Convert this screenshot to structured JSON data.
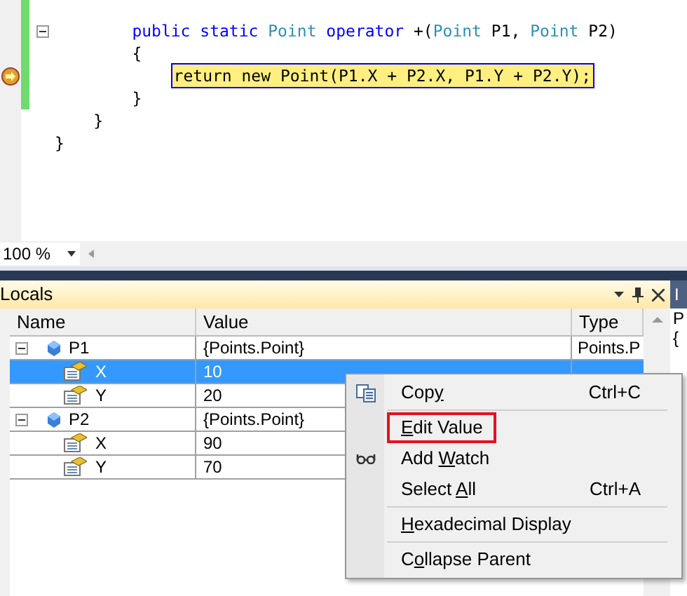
{
  "editor": {
    "lines": [
      {
        "children": [
          {
            "children": [
              {
                "collapsible": true,
                "current": false,
                "tokens": [
                  {
                    "kind": "keyword",
                    "text": "public static "
                  },
                  {
                    "kind": "type",
                    "text": "Point "
                  },
                  {
                    "kind": "keyword",
                    "text": "operator "
                  },
                  {
                    "kind": "plain",
                    "text": "+("
                  },
                  {
                    "kind": "type",
                    "text": "Point "
                  },
                  {
                    "kind": "plain",
                    "text": "P1, "
                  },
                  {
                    "kind": "type",
                    "text": "Point "
                  },
                  {
                    "kind": "plain",
                    "text": "P2)"
                  }
                ]
              },
              {
                "collapsible": false,
                "current": false,
                "tokens": [
                  {
                    "kind": "plain",
                    "text": "{"
                  }
                ],
                "children": [
                  {
                    "collapsible": false,
                    "current": true,
                    "tokens": [
                      {
                        "kind": "plain",
                        "text": "return new Point(P1.X + P2.X, P1.Y + P2.Y);"
                      }
                    ]
                  }
                ]
              },
              {
                "collapsible": false,
                "current": false,
                "tokens": [
                  {
                    "kind": "plain",
                    "text": "}"
                  }
                ]
              }
            ]
          },
          {
            "collapsible": false,
            "current": false,
            "tokens": [
              {
                "kind": "plain",
                "text": "}"
              }
            ]
          }
        ]
      },
      {
        "collapsible": false,
        "current": false,
        "tokens": [
          {
            "kind": "plain",
            "text": "}"
          }
        ]
      }
    ],
    "zoom": "100 %"
  },
  "locals": {
    "title": "Locals",
    "columns": [
      "Name",
      "Value",
      "Type"
    ],
    "rows": [
      {
        "kind": "object",
        "name": "P1",
        "value": "{Points.Point}",
        "type": "Points.P",
        "selected": false,
        "children": [
          {
            "kind": "field",
            "name": "X",
            "value": "10",
            "selected": true
          },
          {
            "kind": "field",
            "name": "Y",
            "value": "20",
            "selected": false
          }
        ]
      },
      {
        "kind": "object",
        "name": "P2",
        "value": "{Points.Point}",
        "selected": false,
        "children": [
          {
            "kind": "field",
            "name": "X",
            "value": "90",
            "selected": false
          },
          {
            "kind": "field",
            "name": "Y",
            "value": "70",
            "selected": false
          }
        ]
      }
    ]
  },
  "side_pane": {
    "title": "I",
    "lines": [
      "P",
      "{"
    ]
  },
  "context_menu": {
    "items": [
      {
        "kind": "copy",
        "before": "Cop",
        "key": "y",
        "shortcut": "Ctrl+C",
        "highlighted": false,
        "separator_after": true
      },
      {
        "kind": "plain",
        "key": "E",
        "after": "dit Value",
        "highlighted": true,
        "separator_after": false
      },
      {
        "kind": "watch",
        "before": "Add ",
        "key": "W",
        "after": "atch",
        "highlighted": false,
        "separator_after": false
      },
      {
        "kind": "plain",
        "before": "Select ",
        "key": "A",
        "after": "ll",
        "shortcut": "Ctrl+A",
        "highlighted": false,
        "separator_after": true
      },
      {
        "kind": "plain",
        "key": "H",
        "after": "exadecimal Display",
        "highlighted": false,
        "separator_after": true
      },
      {
        "kind": "plain",
        "before": "C",
        "key": "o",
        "after": "llapse Parent",
        "highlighted": false,
        "separator_after": false
      }
    ]
  }
}
